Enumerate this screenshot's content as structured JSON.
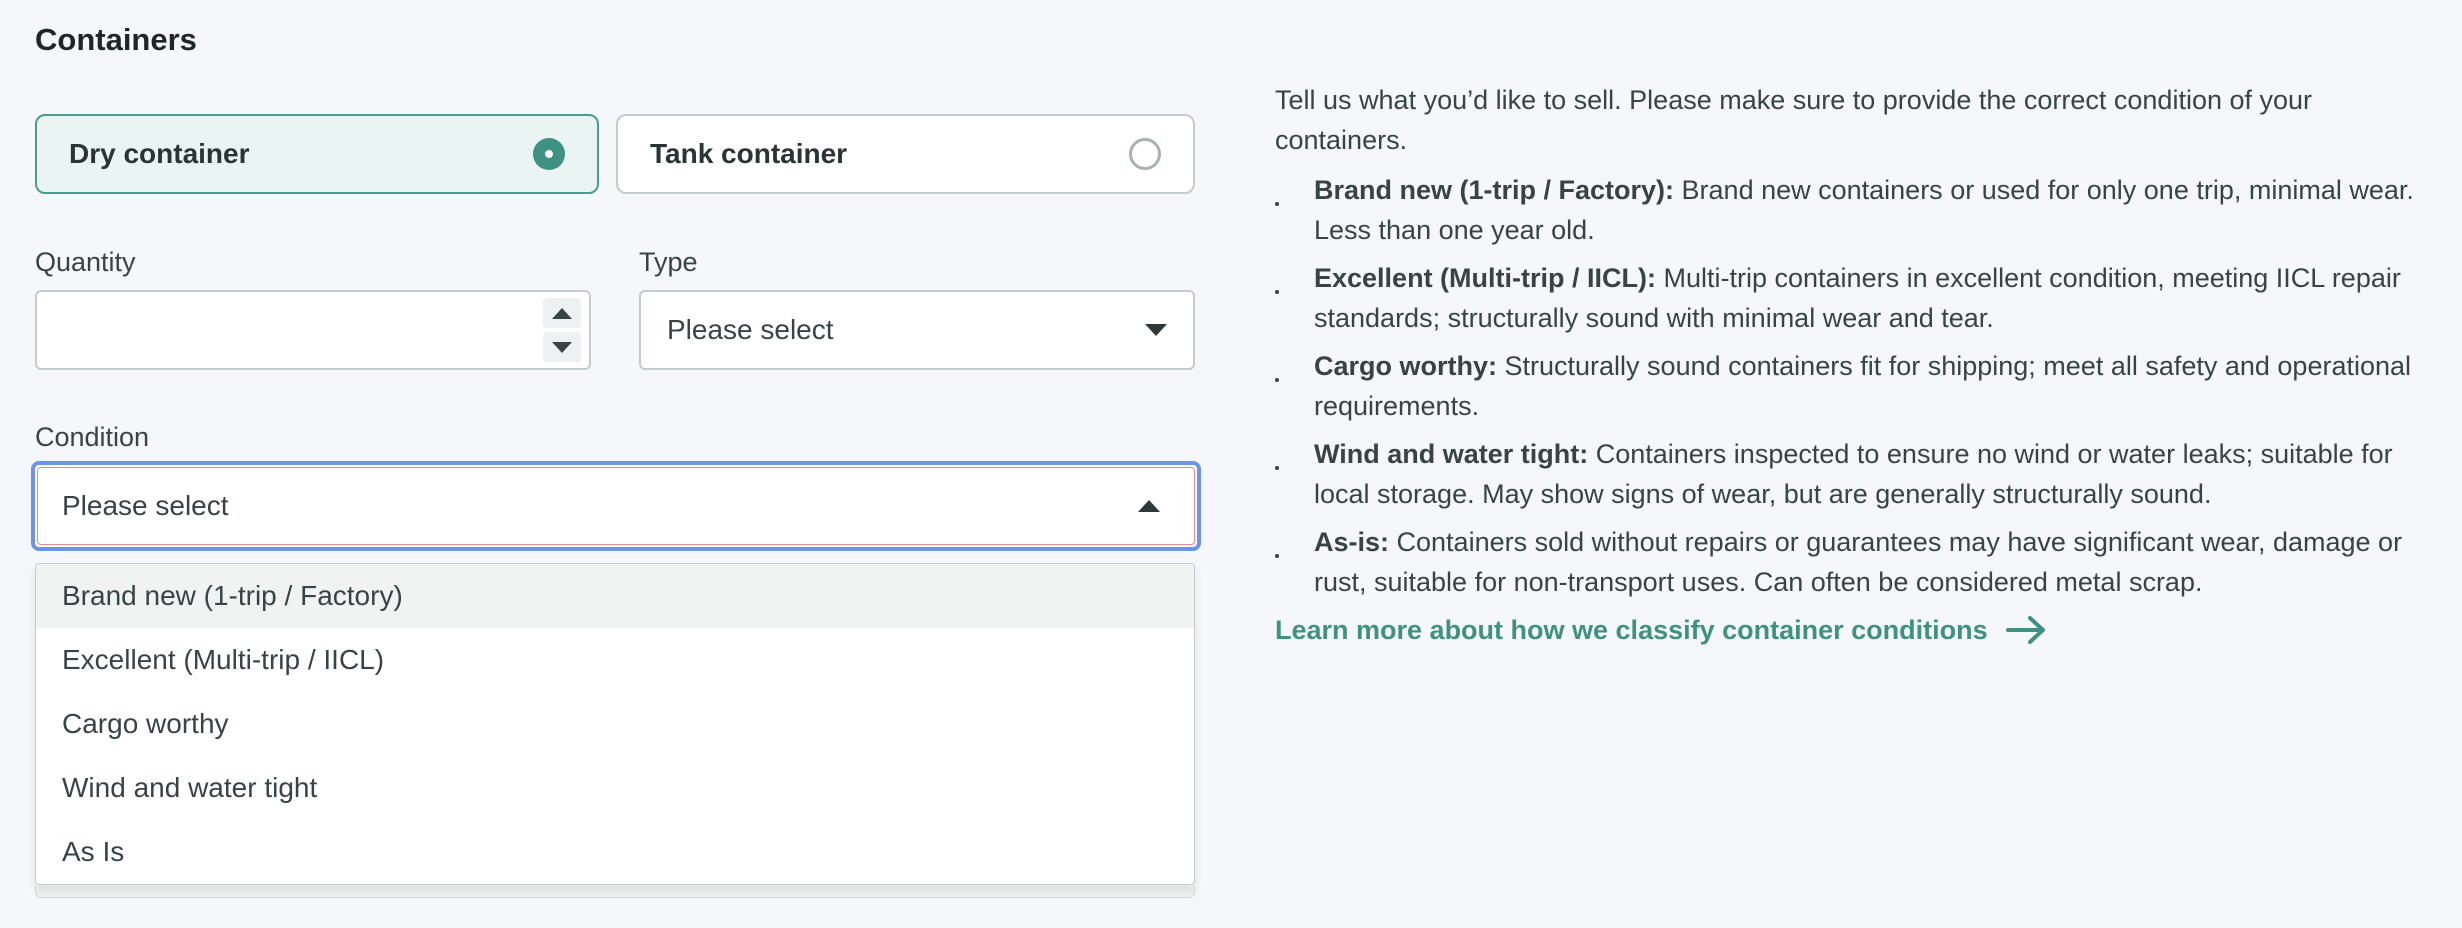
{
  "section": {
    "title": "Containers"
  },
  "container_type": {
    "options": [
      {
        "label": "Dry container",
        "selected": true
      },
      {
        "label": "Tank container",
        "selected": false
      }
    ]
  },
  "quantity": {
    "label": "Quantity",
    "value": ""
  },
  "type": {
    "label": "Type",
    "selected": "Please select"
  },
  "condition": {
    "label": "Condition",
    "selected": "Please select",
    "options": [
      "Brand new (1-trip / Factory)",
      "Excellent (Multi-trip / IICL)",
      "Cargo worthy",
      "Wind and water tight",
      "As Is"
    ]
  },
  "info": {
    "intro": "Tell us what you’d like to sell. Please make sure to provide the correct condition of your containers.",
    "items": [
      {
        "term": "Brand new (1-trip / Factory):",
        "desc": " Brand new containers or used for only one trip, minimal wear. Less than one year old."
      },
      {
        "term": "Excellent (Multi-trip / IICL):",
        "desc": " Multi-trip containers in excellent condition, meeting IICL repair standards; structurally sound with minimal wear and tear."
      },
      {
        "term": "Cargo worthy:",
        "desc": " Structurally sound containers fit for shipping; meet all safety and operational requirements."
      },
      {
        "term": "Wind and water tight:",
        "desc": " Containers inspected to ensure no wind or water leaks; suitable for local storage. May show signs of wear, but are generally structurally sound."
      },
      {
        "term": "As-is:",
        "desc": " Containers sold without repairs or guarantees may have significant wear, damage or rust, suitable for non-transport uses. Can often be considered metal scrap."
      }
    ],
    "link_text": "Learn more about how we classify container conditions"
  },
  "colors": {
    "accent": "#3f9181",
    "focus_ring": "#6f93e8",
    "selected_card_bg": "#eaf5f3"
  },
  "icons": {
    "radio_selected": "radio-selected-icon",
    "radio_unselected": "radio-unselected-icon",
    "select_arrow": "chevron-down-icon",
    "link_arrow": "arrow-right-icon"
  }
}
